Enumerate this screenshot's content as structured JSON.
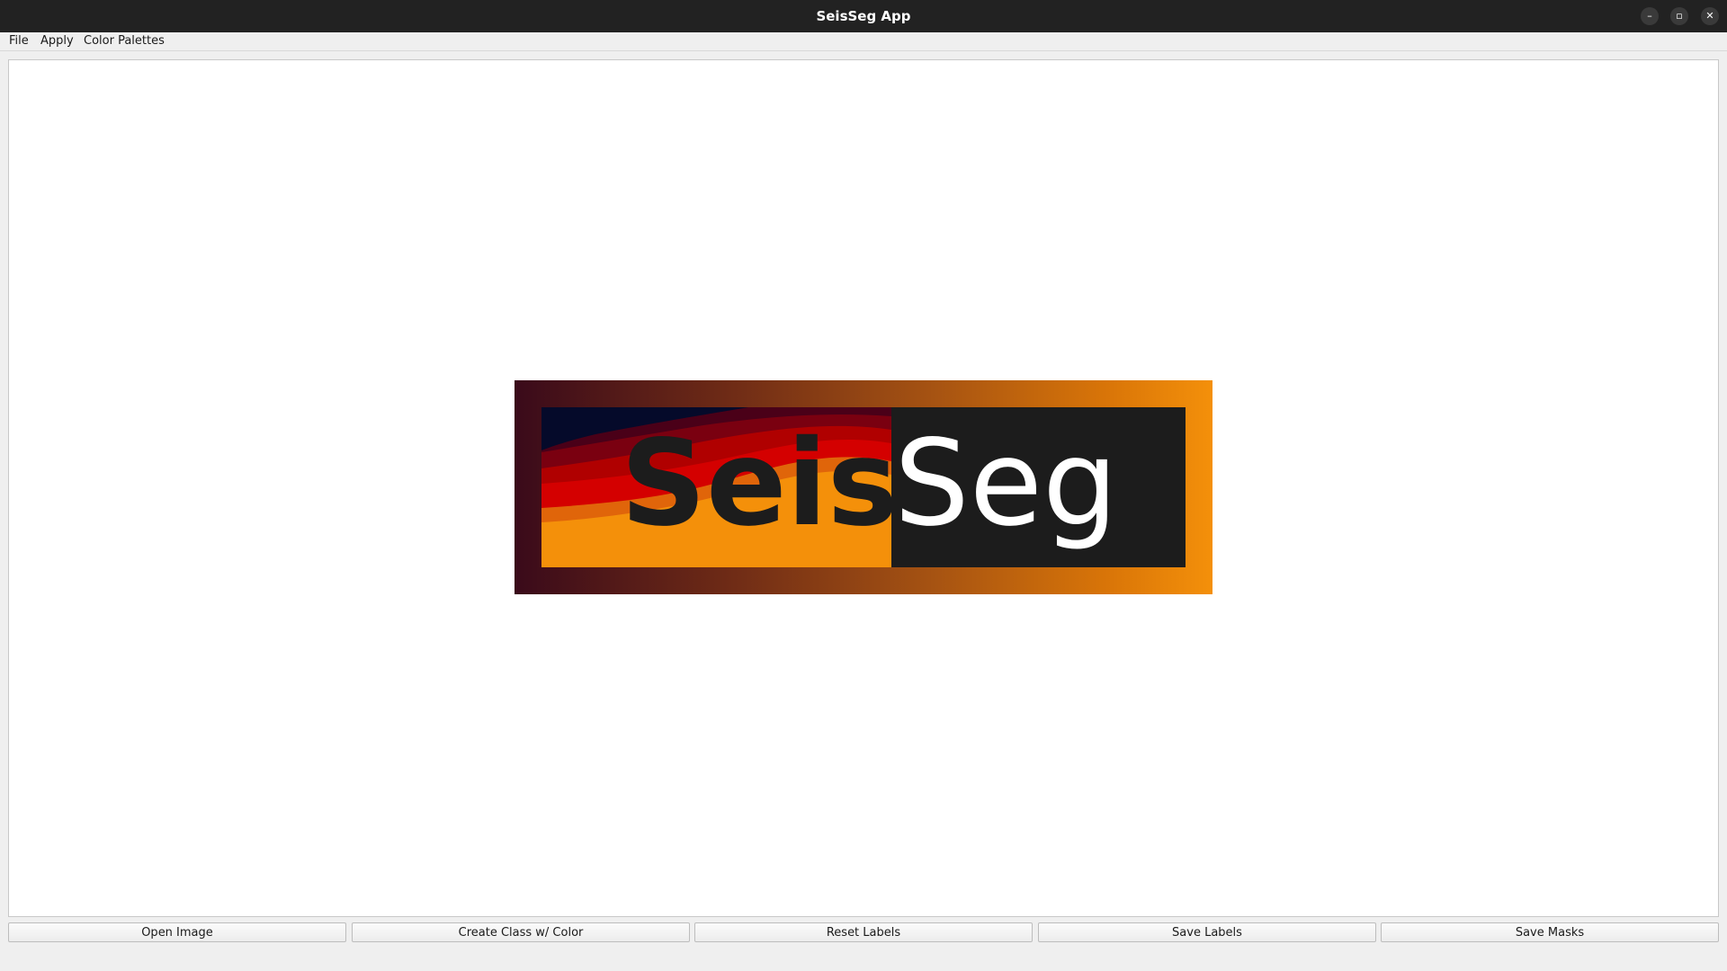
{
  "window": {
    "title": "SeisSeg App",
    "controls": {
      "minimize": "–",
      "maximize": "▫",
      "close": "✕"
    }
  },
  "menu": {
    "items": [
      "File",
      "Apply",
      "Color Palettes"
    ]
  },
  "logo": {
    "text_part1": "Seis",
    "text_part2": "Seg"
  },
  "buttons": {
    "open_image": "Open Image",
    "create_class": "Create Class w/ Color",
    "reset_labels": "Reset Labels",
    "save_labels": "Save Labels",
    "save_masks": "Save Masks"
  },
  "colors": {
    "titlebar": "#222222",
    "logo_gradient_start": "#3a0a1a",
    "logo_gradient_end": "#f4900a",
    "logo_dark": "#1c1c1c"
  }
}
